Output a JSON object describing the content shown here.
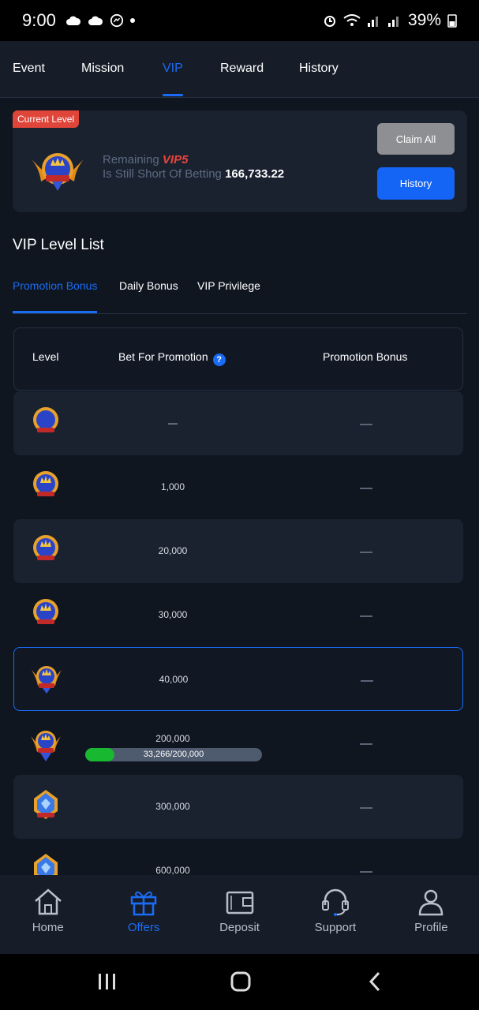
{
  "status_bar": {
    "time": "9:00",
    "battery": "39%"
  },
  "top_tabs": [
    {
      "label": "Event"
    },
    {
      "label": "Mission"
    },
    {
      "label": "VIP"
    },
    {
      "label": "Reward"
    },
    {
      "label": "History"
    }
  ],
  "active_top_tab": "VIP",
  "level_card": {
    "badge": "Current Level",
    "remaining_label": "Remaining",
    "vip_label": "VIP5",
    "short_label": "Is Still Short Of Betting",
    "short_amount": "166,733.22",
    "claim_all_label": "Claim All",
    "history_label": "History"
  },
  "list_title": "VIP Level List",
  "sub_tabs": [
    {
      "label": "Promotion Bonus"
    },
    {
      "label": "Daily Bonus"
    },
    {
      "label": "VIP Privilege"
    }
  ],
  "table": {
    "headers": {
      "level": "Level",
      "bet": "Bet For Promotion",
      "bonus": "Promotion Bonus"
    },
    "help_icon": "?",
    "rows": [
      {
        "level": "VIP0",
        "bet": "—",
        "bonus": "—"
      },
      {
        "level": "VIP1",
        "bet": "1,000",
        "bonus": "—"
      },
      {
        "level": "VIP2",
        "bet": "20,000",
        "bonus": "—"
      },
      {
        "level": "VIP3",
        "bet": "30,000",
        "bonus": "—"
      },
      {
        "level": "VIP4",
        "bet": "40,000",
        "bonus": "—",
        "current": true
      },
      {
        "level": "VIP5",
        "bet": "200,000",
        "bonus": "—",
        "progress_text": "33,266/200,000",
        "progress": 0.166
      },
      {
        "level": "VIP6",
        "bet": "300,000",
        "bonus": "—"
      },
      {
        "level": "VIP7",
        "bet": "600,000",
        "bonus": "—"
      }
    ]
  },
  "bottom_nav": [
    {
      "label": "Home",
      "icon": "home-icon"
    },
    {
      "label": "Offers",
      "icon": "gift-icon"
    },
    {
      "label": "Deposit",
      "icon": "wallet-icon"
    },
    {
      "label": "Support",
      "icon": "headset-icon"
    },
    {
      "label": "Profile",
      "icon": "user-icon"
    }
  ],
  "active_nav": "Offers",
  "colors": {
    "accent": "#1a6cf5",
    "danger": "#e0453a",
    "progress": "#18b830",
    "background": "#0f1620",
    "card": "#1a2230"
  }
}
